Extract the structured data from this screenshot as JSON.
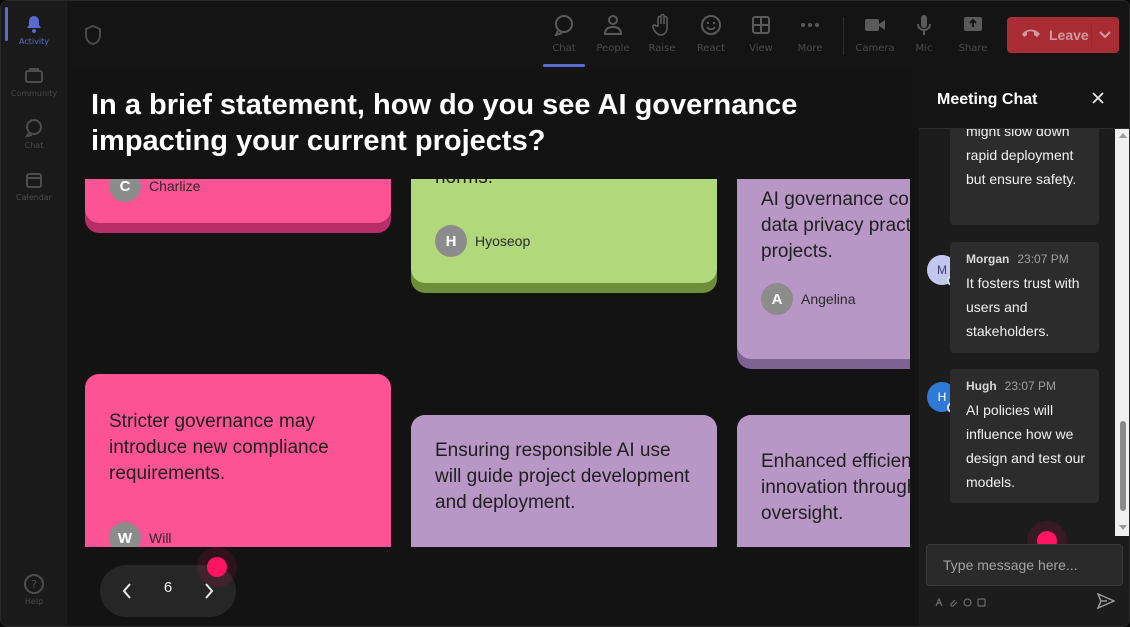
{
  "rail": {
    "items": [
      {
        "label": "Activity",
        "icon": "bell-icon",
        "active": true
      },
      {
        "label": "Community",
        "icon": "community-icon"
      },
      {
        "label": "Chat",
        "icon": "chat-bubble-icon"
      },
      {
        "label": "Calendar",
        "icon": "calendar-icon"
      },
      {
        "label": "Help",
        "icon": "help-icon"
      }
    ]
  },
  "toolbar": {
    "chat": "Chat",
    "people": "People",
    "raise": "Raise",
    "react": "React",
    "view": "View",
    "more": "More",
    "camera": "Camera",
    "mic": "Mic",
    "share": "Share",
    "leave": "Leave"
  },
  "question": "In a brief statement, how do you see AI governance impacting your current projects?",
  "cards": {
    "c1": {
      "author_initial": "C",
      "author": "Charlize"
    },
    "c2": {
      "text": "norms.",
      "author_initial": "H",
      "author": "Hyoseop"
    },
    "c3": {
      "text": "AI governance could affect data privacy practices in projects.",
      "author_initial": "A",
      "author": "Angelina"
    },
    "c4": {
      "text": "Stricter governance may introduce new compliance requirements.",
      "author_initial": "W",
      "author": "Will"
    },
    "c5": {
      "text": "Ensuring responsible AI use will guide project development and deployment."
    },
    "c6": {
      "text": "Enhanced efficiency and innovation through ethical oversight."
    }
  },
  "pager": {
    "page": "6"
  },
  "chat": {
    "title": "Meeting Chat",
    "messages": [
      {
        "text": "might slow down rapid deployment but ensure safety."
      },
      {
        "author": "Morgan",
        "initial": "M",
        "time": "23:07 PM",
        "text": "It fosters trust with users and stakeholders."
      },
      {
        "author": "Hugh",
        "initial": "H",
        "time": "23:07 PM",
        "text": "AI policies will influence how we design and test our models."
      }
    ],
    "placeholder": "Type message here..."
  },
  "colors": {
    "accent": "#5b6ad0",
    "leave": "#c4313b",
    "pink_card": "#fb5393",
    "green_card": "#b1d87a",
    "purple_card": "#b896c6",
    "cursor": "#ff1464"
  }
}
